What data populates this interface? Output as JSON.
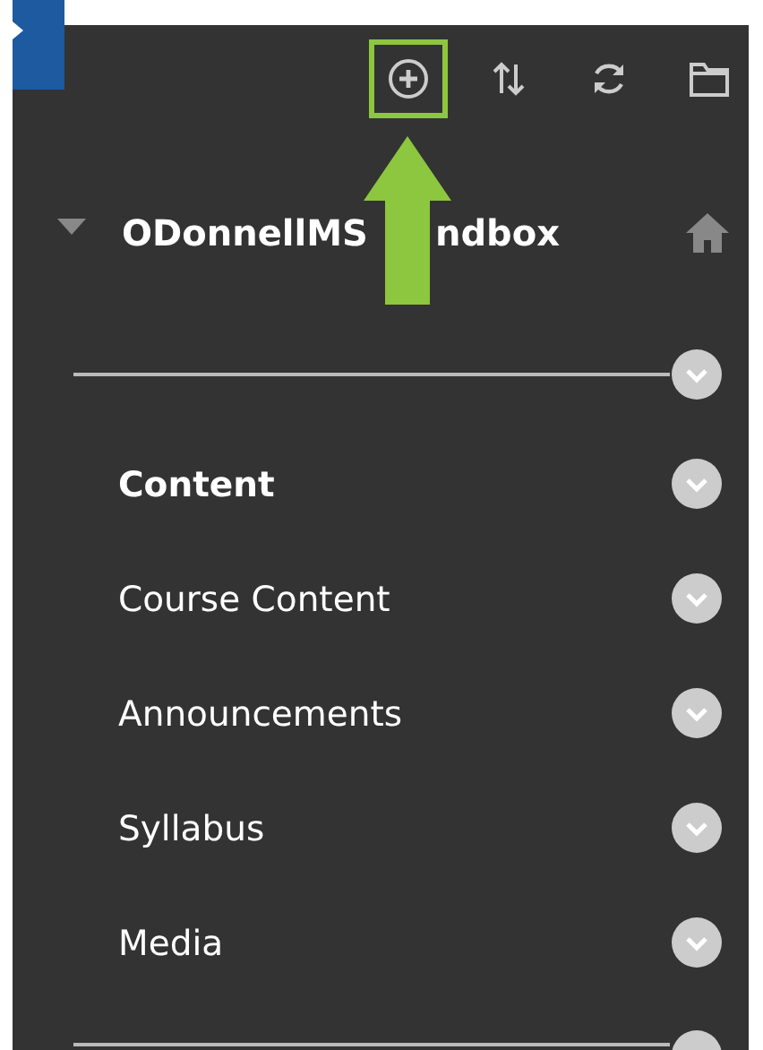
{
  "toolbar": [
    {
      "kind": "add",
      "highlighted": true
    },
    {
      "kind": "sort",
      "highlighted": false
    },
    {
      "kind": "refresh",
      "highlighted": false
    },
    {
      "kind": "folder",
      "highlighted": false
    }
  ],
  "course": {
    "title_parts": [
      "ODonnellMS",
      "ndbox"
    ],
    "expanded": true
  },
  "menu_items": [
    {
      "label": "Content",
      "kind": "heading"
    },
    {
      "label": "Course Content",
      "kind": "link"
    },
    {
      "label": "Announcements",
      "kind": "link"
    },
    {
      "label": "Syllabus",
      "kind": "link"
    },
    {
      "label": "Media",
      "kind": "link"
    }
  ]
}
